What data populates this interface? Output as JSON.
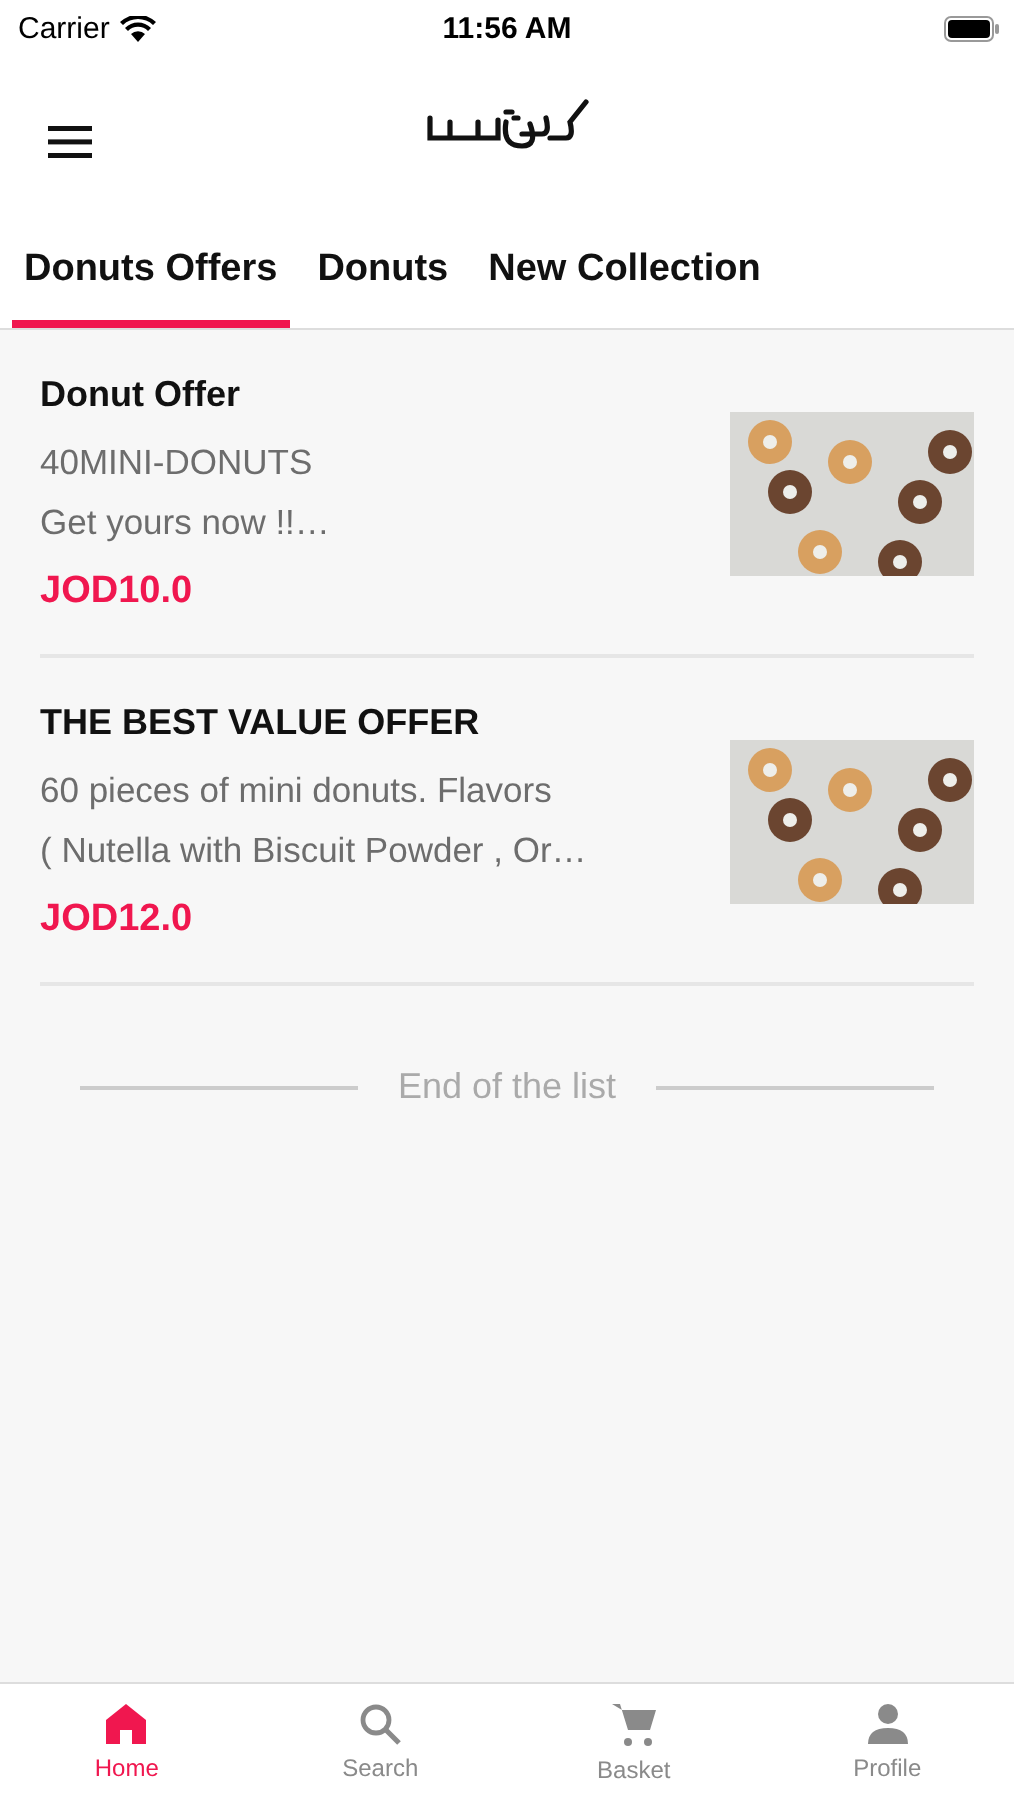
{
  "status_bar": {
    "carrier": "Carrier",
    "time": "11:56 AM"
  },
  "tabs": [
    {
      "label": "Donuts Offers",
      "selected": true
    },
    {
      "label": "Donuts",
      "selected": false
    },
    {
      "label": "New Collection",
      "selected": false
    }
  ],
  "offers": [
    {
      "title": "Donut Offer",
      "lines": [
        "40MINI-DONUTS",
        "Get yours now !!…"
      ],
      "price": "JOD10.0",
      "image": {
        "kind": "picture"
      }
    },
    {
      "title": "THE BEST VALUE OFFER",
      "lines": [
        "60 pieces of mini donuts. Flavors",
        "( Nutella with Biscuit Powder , Or…"
      ],
      "price": "JOD12.0",
      "image": {
        "kind": "picture"
      }
    }
  ],
  "end_text": "End of the list",
  "bottom_nav": [
    {
      "label": "Home",
      "kind": "home",
      "selected": true
    },
    {
      "label": "Search",
      "kind": "search",
      "selected": false
    },
    {
      "label": "Basket",
      "kind": "basket",
      "selected": false
    },
    {
      "label": "Profile",
      "kind": "profile",
      "selected": false
    }
  ]
}
